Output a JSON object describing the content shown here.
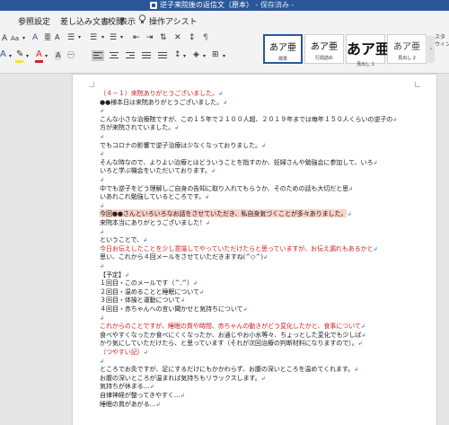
{
  "window": {
    "title": "逆子来院後の返信文（原本）",
    "status": "- 保存済み -"
  },
  "menu": {
    "tabs": [
      "参照設定",
      "差し込み文書",
      "校閲",
      "表示"
    ],
    "assist": "操作アシスト"
  },
  "ribbon": {
    "styles": [
      {
        "sample": "あア亜",
        "name": "標準"
      },
      {
        "sample": "あア亜",
        "name": "行間詰め"
      },
      {
        "sample": "あア亜",
        "name": "見出し 1"
      },
      {
        "sample": "あア亜",
        "name": "見出し 2"
      }
    ],
    "styles_pane": "スタ\nウィン",
    "colors": {
      "accent": "#2b579a",
      "highlight_yellow": "#f4e33a",
      "font_red": "#d22222"
    }
  },
  "document": {
    "lines": [
      "（４－１）来院ありがとうございました。",
      "●●様本日は来院ありがとうございました。",
      "",
      "こんな小さな治療院ですが、この１５年で２１００人超、２０１９年までは毎年１５０人くらいの逆子の",
      "方が来院されていました。",
      "",
      "でもコロナの影響で逆子治療は少なくなっておりました。",
      "",
      "そんな時なので、よりよい治療とはどういうことを指すのか、妊婦さんや勉強会に参加して、いろ",
      "いろと学ぶ機会をいただいております。",
      "",
      "中でも逆子をどう理解しご自身の告知に取り入れてもらうか、そのための話も大切だと思",
      "いあれこれ勉強しているところです。",
      "",
      "今回●●さんといろいろなお話をさせていただき、私自身気づくことが多々ありました。",
      "来院本当にありがとうございました！",
      "",
      "ということで、",
      "今日お伝えしたことを少し意識してやっていただけたらと思っていますが、お伝え漏れもあるかと",
      "思い、これから４回メールをさせていただきますね(^◇^)",
      "",
      "【予定】",
      "１回目・このメールです（^.^）",
      "２回目・温めることと睡眠について",
      "３回目・体操と運動について",
      "４回目・赤ちゃんへの言い聞かせと気持ちについて",
      "",
      "これからのことですが、睡眠の質や時間、赤ちゃんの動きがどう変化したかと、食事について",
      "食べやすくなったか食べにくくなったか、お通じやお小水等々、ちょっとした変化でも少しば",
      "かり気にしていただけたら、と思っています（それが次回治療の判断材料になりますので）。",
      "（つやすい記）",
      "",
      "ところでお灸ですが、足にするだけにもかかわらず、お腹の深いところを温めてくれます。",
      "お腹の深いところが温まれば気持ちもリラックスします。",
      "気持ちが休まる…",
      "自律神経が整ってきやすく…",
      "睡眠の質があがる…"
    ]
  }
}
